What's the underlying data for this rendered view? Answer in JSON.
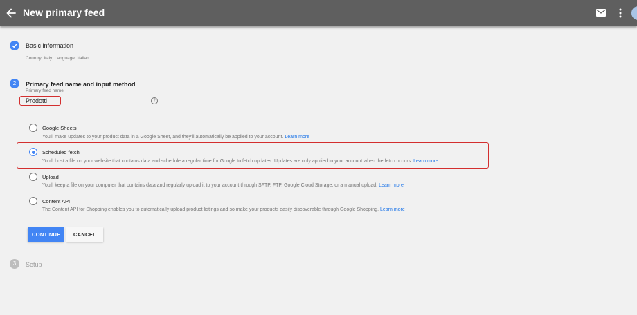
{
  "header": {
    "title": "New primary feed",
    "back_icon": "arrow-back-icon",
    "mail_icon": "mail-icon",
    "more_icon": "more-vert-icon"
  },
  "steps": [
    {
      "number": "1",
      "title": "Basic information",
      "subtitle": "Country: Italy; Language: Italian",
      "state": "done"
    },
    {
      "number": "2",
      "title": "Primary feed name and input method",
      "state": "active"
    },
    {
      "number": "3",
      "title": "Setup",
      "state": "pending"
    }
  ],
  "feed_name": {
    "label": "Primary feed name",
    "value": "Prodotti",
    "help_icon": "help-icon"
  },
  "input_methods": [
    {
      "title": "Google Sheets",
      "description": "You'll make updates to your product data in a Google Sheet, and they'll automatically be applied to your account.",
      "link": "Learn more",
      "selected": false
    },
    {
      "title": "Scheduled fetch",
      "description": "You'll host a file on your website that contains data and schedule a regular time for Google to fetch updates. Updates are only applied to your account when the fetch occurs.",
      "link": "Learn more",
      "selected": true
    },
    {
      "title": "Upload",
      "description": "You'll keep a file on your computer that contains data and regularly upload it to your account through SFTP, FTP, Google Cloud Storage, or a manual upload.",
      "link": "Learn more",
      "selected": false
    },
    {
      "title": "Content API",
      "description": "The Content API for Shopping enables you to automatically upload product listings and so make your products easily discoverable through Google Shopping.",
      "link": "Learn more",
      "selected": false
    }
  ],
  "actions": {
    "continue_label": "CONTINUE",
    "cancel_label": "CANCEL"
  },
  "colors": {
    "accent": "#4285f4",
    "highlight": "#d32f2f",
    "topbar": "#5f5f5f"
  }
}
